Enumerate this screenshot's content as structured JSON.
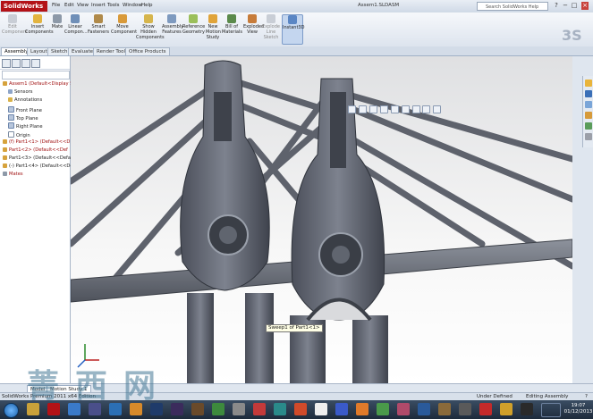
{
  "app": {
    "logo": "SolidWorks",
    "window_title": "Assem1.SLDASM",
    "menu": [
      "File",
      "Edit",
      "View",
      "Insert",
      "Tools",
      "Window",
      "Help"
    ],
    "help_search_placeholder": "Search SolidWorks Help",
    "win_controls": [
      "?",
      "−",
      "□",
      "×"
    ]
  },
  "ribbon": {
    "buttons": [
      {
        "label": "Edit Component",
        "enabled": false
      },
      {
        "label": "Insert Components",
        "enabled": true
      },
      {
        "label": "Mate",
        "enabled": true
      },
      {
        "label": "Linear Compon...",
        "enabled": true
      },
      {
        "label": "Smart Fasteners",
        "enabled": true
      },
      {
        "label": "Move Component",
        "enabled": true
      },
      {
        "label": "Show Hidden Components",
        "enabled": true
      },
      {
        "label": "Assembly Features",
        "enabled": true
      },
      {
        "label": "Reference Geometry",
        "enabled": true
      },
      {
        "label": "New Motion Study",
        "enabled": true
      },
      {
        "label": "Bill of Materials",
        "enabled": true
      },
      {
        "label": "Exploded View",
        "enabled": true
      },
      {
        "label": "Explode Line Sketch",
        "enabled": false
      },
      {
        "label": "Instant3D",
        "enabled": true
      }
    ]
  },
  "tabs": [
    "Assembly",
    "Layout",
    "Sketch",
    "Evaluate",
    "Render Tools",
    "Office Products"
  ],
  "active_tab": "Assembly",
  "tree": [
    {
      "label": "Assem1  (Default<Display St",
      "red": true
    },
    {
      "label": "Sensors",
      "red": false
    },
    {
      "label": "Annotations",
      "red": false
    },
    {
      "label": "Front Plane",
      "red": false
    },
    {
      "label": "Top Plane",
      "red": false
    },
    {
      "label": "Right Plane",
      "red": false
    },
    {
      "label": "Origin",
      "red": false
    },
    {
      "label": "(f) Part1<1> (Default<<D",
      "red": true
    },
    {
      "label": "Part1<2> (Default<<Def",
      "red": true
    },
    {
      "label": "Part1<3> (Default<<Default",
      "red": false
    },
    {
      "label": "(-) Part1<4> (Default<<Def",
      "red": false
    },
    {
      "label": "Mates",
      "red": true
    }
  ],
  "viewport": {
    "tooltip": "Sweep1 of Part1<1>"
  },
  "lower_tabs": [
    "Model",
    "Motion Study 1"
  ],
  "status": {
    "left": "SolidWorks Premium 2011 x64 Edition",
    "mid1": "Under Defined",
    "mid2": "Editing Assembly",
    "help_icon": "?"
  },
  "taskbar": {
    "time": "19:07",
    "date": "01/12/2013"
  },
  "watermark": "菁西网"
}
